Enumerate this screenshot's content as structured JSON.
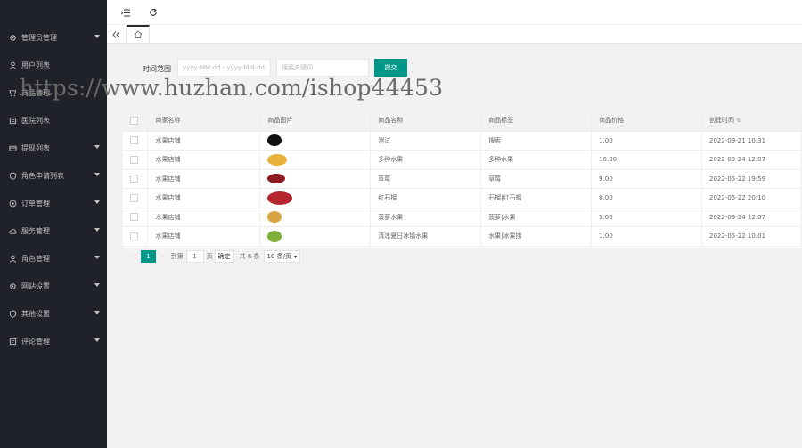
{
  "sidebar": {
    "items": [
      {
        "label": "管理员管理",
        "icon": "gear-icon",
        "has_arrow": true
      },
      {
        "label": "用户列表",
        "icon": "user-icon",
        "has_arrow": false
      },
      {
        "label": "商品管理",
        "icon": "cart-icon",
        "has_arrow": false
      },
      {
        "label": "医院列表",
        "icon": "list-icon",
        "has_arrow": false
      },
      {
        "label": "提现列表",
        "icon": "card-icon",
        "has_arrow": true
      },
      {
        "label": "角色申请列表",
        "icon": "shield-icon",
        "has_arrow": true
      },
      {
        "label": "订单管理",
        "icon": "target-icon",
        "has_arrow": true
      },
      {
        "label": "服务管理",
        "icon": "cloud-icon",
        "has_arrow": true
      },
      {
        "label": "角色管理",
        "icon": "user-icon",
        "has_arrow": true
      },
      {
        "label": "网站设置",
        "icon": "settings-icon",
        "has_arrow": true
      },
      {
        "label": "其他设置",
        "icon": "shield-icon",
        "has_arrow": true
      },
      {
        "label": "评论管理",
        "icon": "note-icon",
        "has_arrow": true
      }
    ]
  },
  "topbar": {
    "menu_icon": "menu-fold-icon",
    "refresh_icon": "refresh-icon"
  },
  "tabs": {
    "back_icon": "double-left-icon",
    "home_icon": "home-icon"
  },
  "watermark": "https://www.huzhan.com/ishop44453",
  "filter": {
    "label": "时间范围",
    "date_placeholder": "yyyy-MM-dd - yyyy-MM-dd",
    "keyword_placeholder": "搜索关键词",
    "submit_label": "提交"
  },
  "table": {
    "headers": [
      "商家名称",
      "商品图片",
      "商品名称",
      "商品标签",
      "商品价格",
      "创建时间"
    ],
    "sort_icon": "sort-icon",
    "rows": [
      {
        "shop": "水果店铺",
        "name": "测试",
        "tag": "搜索",
        "price": "1.00",
        "created": "2022-09-21 10:31",
        "thumb_color": "#111111"
      },
      {
        "shop": "水果店铺",
        "name": "多种水果",
        "tag": "多种水果",
        "price": "10.00",
        "created": "2022-09-24 12:07",
        "thumb_color": "#e8b23a"
      },
      {
        "shop": "水果店铺",
        "name": "草莓",
        "tag": "草莓",
        "price": "9.00",
        "created": "2022-05-22 19:59",
        "thumb_color": "#8e1b22"
      },
      {
        "shop": "水果店铺",
        "name": "红石榴",
        "tag": "石榴|红石榴",
        "price": "8.00",
        "created": "2022-05-22 20:10",
        "thumb_color": "#b3262d"
      },
      {
        "shop": "水果店铺",
        "name": "菠萝水果",
        "tag": "菠萝|水果",
        "price": "5.00",
        "created": "2022-09-24 12:07",
        "thumb_color": "#d9a441"
      },
      {
        "shop": "水果店铺",
        "name": "清凉夏日冰镇水果",
        "tag": "水果|冰果捞",
        "price": "1.00",
        "created": "2022-05-22 10:01",
        "thumb_color": "#7fae3a"
      }
    ]
  },
  "pager": {
    "current_page": "1",
    "goto_label": "到第",
    "goto_value": "1",
    "page_unit": "页",
    "confirm_label": "确定",
    "total_label": "共 6 条",
    "page_size": "10 条/页"
  },
  "colors": {
    "accent": "#009688",
    "sidebar_bg": "#20222a",
    "content_bg": "#f2f2f2"
  }
}
